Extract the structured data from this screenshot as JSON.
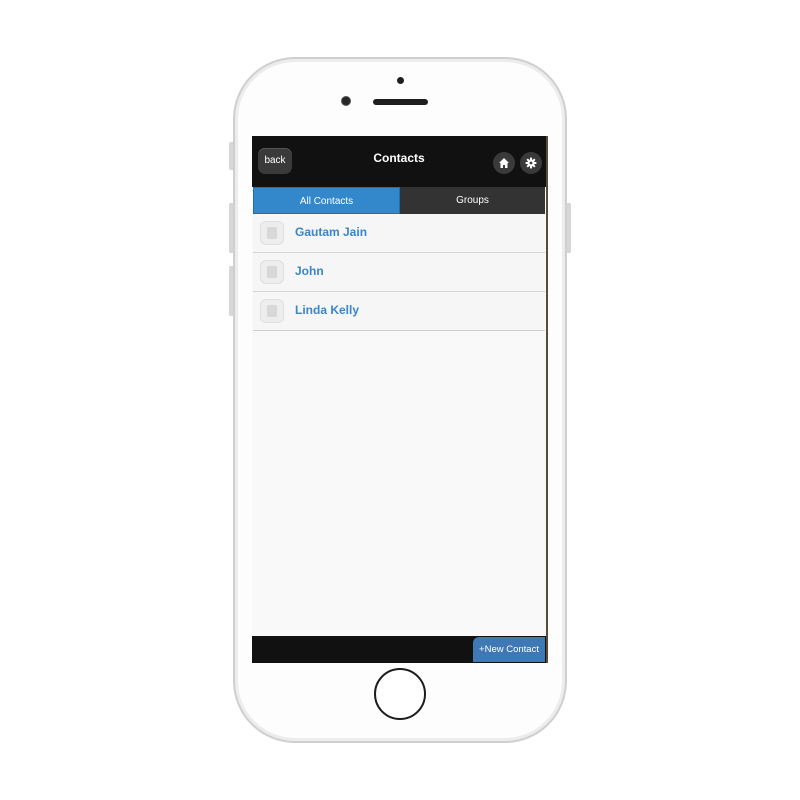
{
  "header": {
    "back_label": "back",
    "title": "Contacts",
    "home_icon": "home-icon",
    "settings_icon": "gear-icon"
  },
  "tabs": [
    {
      "label": "All Contacts",
      "active": true
    },
    {
      "label": "Groups",
      "active": false
    }
  ],
  "contacts": [
    {
      "name": "Gautam Jain"
    },
    {
      "name": "John"
    },
    {
      "name": "Linda Kelly"
    }
  ],
  "footer": {
    "new_contact_label": "+New Contact"
  },
  "colors": {
    "accent": "#3388cc",
    "header_bg": "#111111",
    "contact_name": "#3a86c8",
    "new_contact_button": "#3f79b5"
  }
}
